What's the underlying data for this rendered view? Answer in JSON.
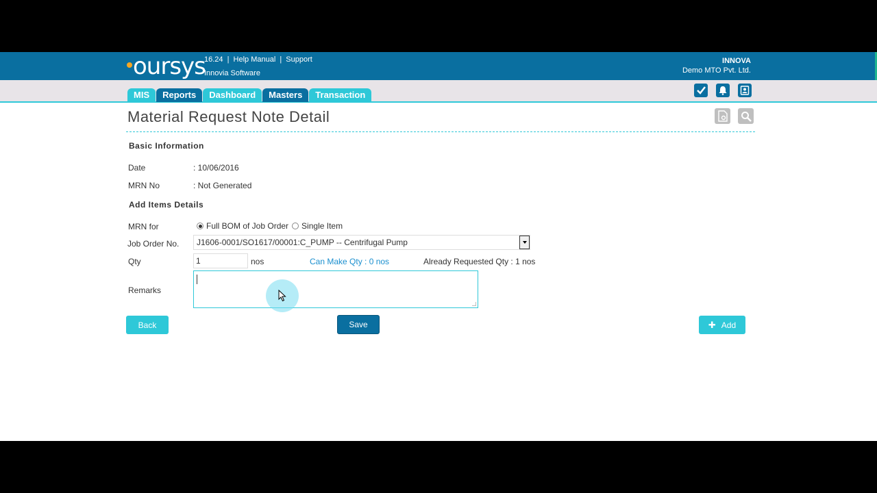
{
  "header": {
    "logo_text": "oursys",
    "version": "16.24",
    "help_manual": "Help Manual",
    "support": "Support",
    "sep": "|",
    "subtitle": "Innovia Software",
    "company_name": "INNOVA",
    "company_sub": "Demo MTO Pvt. Ltd."
  },
  "nav": {
    "tabs": [
      "MIS",
      "Reports",
      "Dashboard",
      "Masters",
      "Transaction"
    ],
    "icons": [
      "checkbox-icon",
      "bell-icon",
      "user-icon"
    ]
  },
  "page": {
    "title": "Material Request Note Detail",
    "title_icons": [
      "document-settings-icon",
      "search-icon"
    ]
  },
  "basic_info": {
    "heading": "Basic Information",
    "date_label": "Date",
    "date_value": ": 10/06/2016",
    "mrn_label": "MRN No",
    "mrn_value": ": Not Generated"
  },
  "items": {
    "heading": "Add Items Details",
    "mrn_for_label": "MRN for",
    "option_full": "Full BOM of Job Order",
    "option_single": "Single Item",
    "selected_option": "Full BOM of Job Order",
    "job_order_label": "Job Order No.",
    "job_order_value": "J1606-0001/SO1617/00001:C_PUMP -- Centrifugal Pump",
    "qty_label": "Qty",
    "qty_value": "1",
    "qty_unit": "nos",
    "can_make": "Can Make Qty : 0 nos",
    "already_requested": "Already Requested Qty : 1 nos",
    "remarks_label": "Remarks",
    "remarks_value": ""
  },
  "actions": {
    "back": "Back",
    "save": "Save",
    "add": "Add"
  },
  "colors": {
    "brand_dark": "#0a6fa0",
    "brand_cyan": "#2ec8d8",
    "link": "#1a8fcf"
  }
}
